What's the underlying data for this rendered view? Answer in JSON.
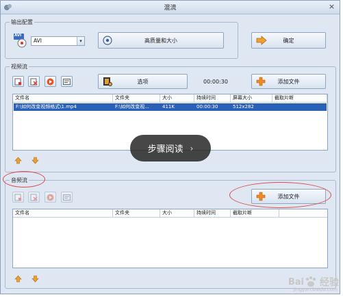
{
  "window": {
    "title": "混流",
    "close_label": "×"
  },
  "output_group": {
    "label": "输出配置",
    "format_value": "AVI",
    "format_badge": "AVI",
    "quality_button": "高质量和大小",
    "ok_button": "确定"
  },
  "video_group": {
    "label": "视频流",
    "options_button": "选项",
    "time": "00:00:30",
    "add_button": "添加文件",
    "columns": [
      "文件名",
      "文件夹",
      "大小",
      "持续时间",
      "屏幕大小",
      "截取片断"
    ],
    "rows": [
      {
        "filename": "F:\\如何改变视频格式\\1.mp4",
        "folder": "F:\\如何改变视...",
        "size": "411K",
        "duration": "00:00:30",
        "screen": "512x282",
        "clip": ""
      }
    ]
  },
  "audio_group": {
    "label": "音频流",
    "add_button": "添加文件",
    "columns": [
      "文件名",
      "文件夹",
      "大小",
      "持续时间",
      "截取片断"
    ]
  },
  "overlay": {
    "text": "步骤阅读",
    "chevron": "›"
  },
  "watermark": {
    "brand": "Bai",
    "brand2": "经验",
    "url": "jingyan.baidu.com"
  },
  "colors": {
    "accent": "#2b60b7",
    "annotation": "#d94a4a"
  }
}
